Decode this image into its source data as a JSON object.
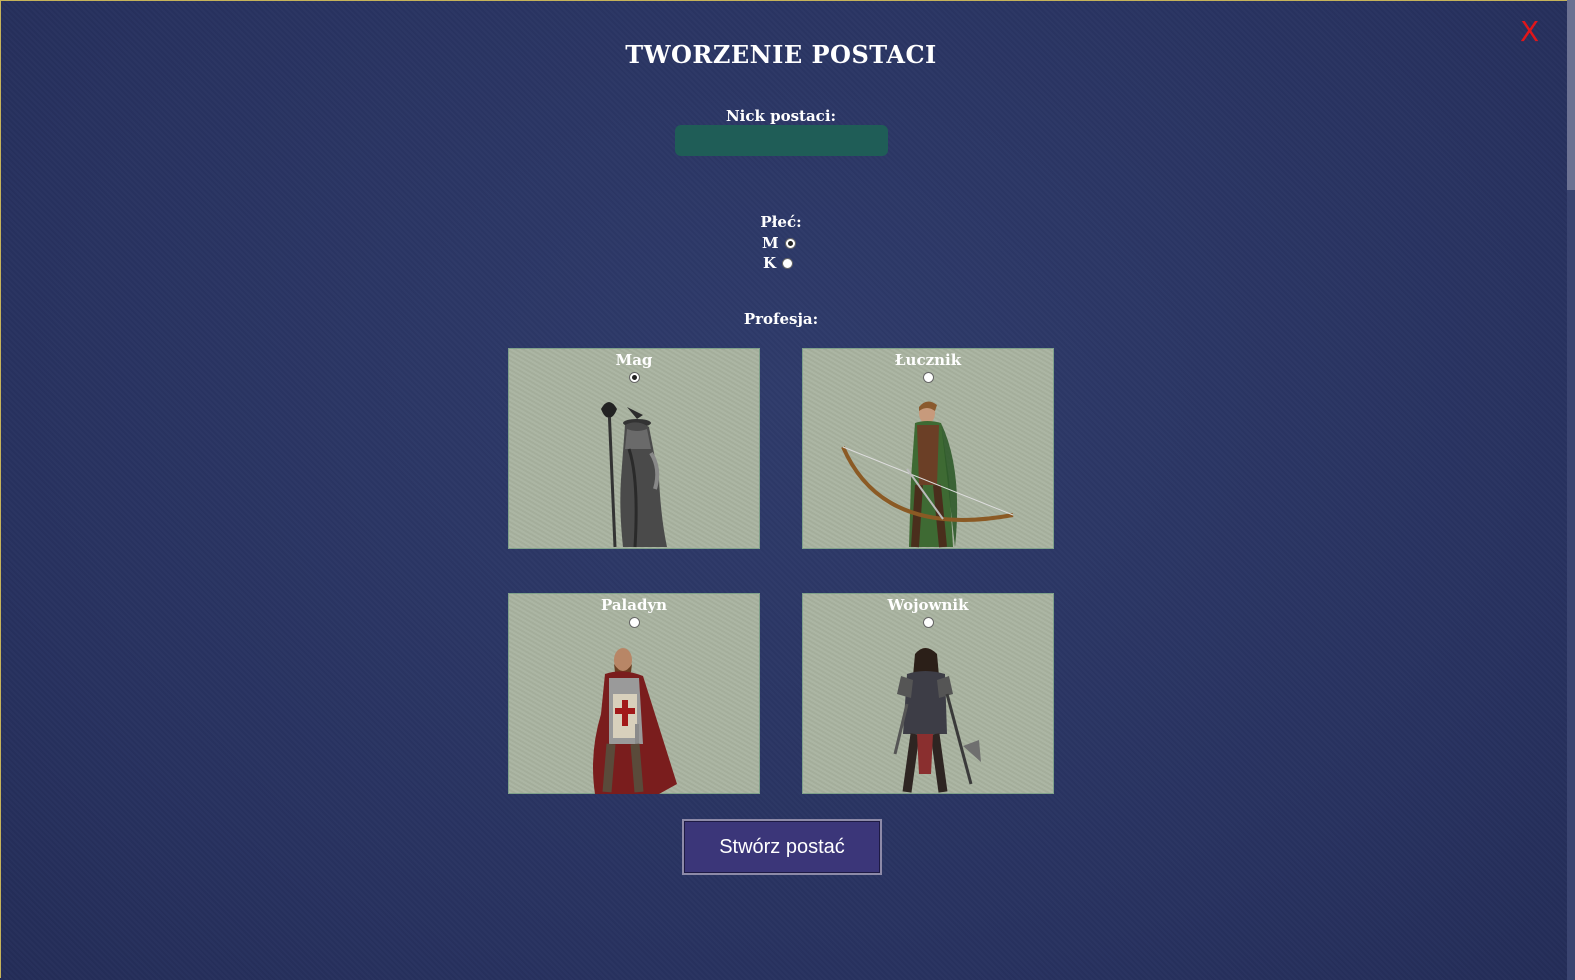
{
  "title": "TWORZENIE POSTACI",
  "close_label": "X",
  "nick": {
    "label": "Nick postaci:",
    "value": "",
    "placeholder": ""
  },
  "gender": {
    "label": "Płeć:",
    "options": [
      {
        "label": "M",
        "checked": true
      },
      {
        "label": "K",
        "checked": false
      }
    ]
  },
  "profession": {
    "label": "Profesja:",
    "options": [
      {
        "label": "Mag",
        "checked": true
      },
      {
        "label": "Łucznik",
        "checked": false
      },
      {
        "label": "Paladyn",
        "checked": false
      },
      {
        "label": "Wojownik",
        "checked": false
      }
    ]
  },
  "create_button": "Stwórz postać",
  "colors": {
    "background": "#2a3563",
    "accent_close": "#e0161a",
    "input_bg": "#1f5d57",
    "card_bg": "#a9b3a0",
    "button_bg": "#3b3679"
  }
}
